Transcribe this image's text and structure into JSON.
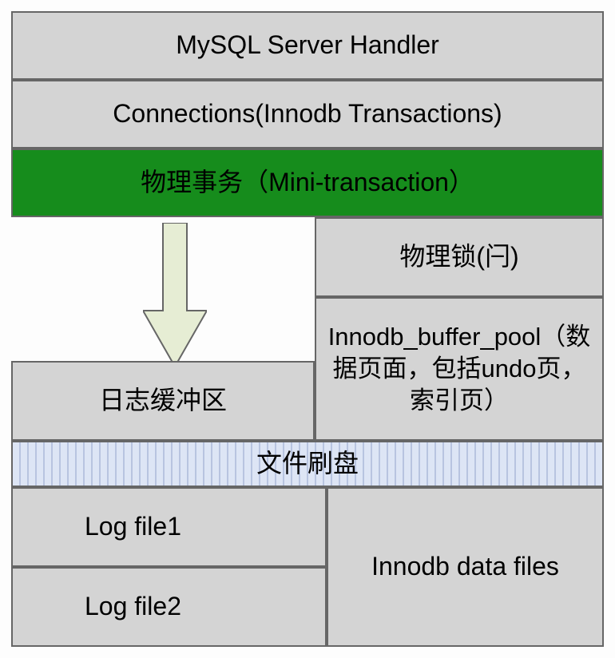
{
  "boxes": {
    "server_handler": "MySQL Server Handler",
    "connections": "Connections(Innodb Transactions)",
    "mini_transaction": "物理事务（Mini-transaction）",
    "physical_lock": "物理锁(闩)",
    "log_buffer": "日志缓冲区",
    "buffer_pool": "Innodb_buffer_pool（数据页面，包括undo页，索引页）",
    "file_flush": "文件刷盘",
    "log_file1": "Log file1",
    "log_file2": "Log file2",
    "data_files": "Innodb data files"
  }
}
